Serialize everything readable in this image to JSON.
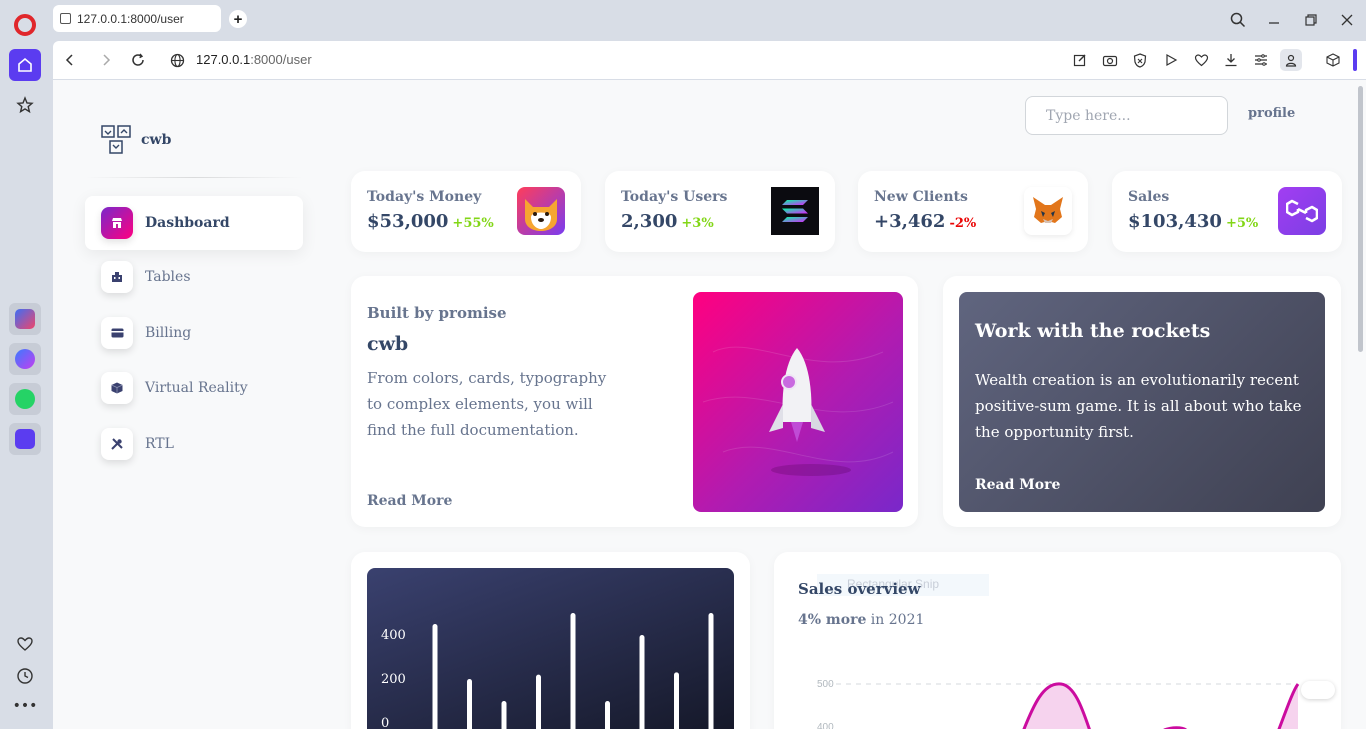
{
  "browser": {
    "tab_title": "127.0.0.1:8000/user",
    "url_host": "127.0.0.1",
    "url_rest": ":8000/user"
  },
  "page": {
    "brand": "cwb",
    "search_placeholder": "Type here...",
    "profile_label": "profile",
    "nav": [
      {
        "label": "Dashboard",
        "icon": "shop-icon",
        "active": true
      },
      {
        "label": "Tables",
        "icon": "office-icon"
      },
      {
        "label": "Billing",
        "icon": "credit-card-icon"
      },
      {
        "label": "Virtual Reality",
        "icon": "box-3d-icon"
      },
      {
        "label": "RTL",
        "icon": "settings-tools-icon"
      }
    ],
    "stats": [
      {
        "label": "Today's Money",
        "value": "$53,000",
        "change": "+55%",
        "icon": "shiba-inu-icon"
      },
      {
        "label": "Today's Users",
        "value": "2,300",
        "change": "+3%",
        "icon": "solana-icon"
      },
      {
        "label": "New Clients",
        "value": "+3,462",
        "change": "-2%",
        "icon": "metamask-fox-icon"
      },
      {
        "label": "Sales",
        "value": "$103,430",
        "change": "+5%",
        "icon": "polygon-icon"
      }
    ],
    "promise": {
      "subtitle": "Built by promise",
      "title": "cwb",
      "text": "From colors, cards, typography to complex elements, you will find the full documentation.",
      "read_more": "Read More"
    },
    "rockets": {
      "title": "Work with the rockets",
      "text": "Wealth creation is an evolutionarily recent positive-sum game. It is all about who take the opportunity first.",
      "read_more": "Read More"
    },
    "sales": {
      "title": "Sales overview",
      "sub_bold": "4% more",
      "sub_rest": " in 2021",
      "overlay_text": "Rectangular Snip"
    }
  },
  "chart_data": [
    {
      "type": "bar",
      "title": "",
      "yticks": [
        "400",
        "200",
        "0"
      ],
      "values": [
        450,
        200,
        100,
        220,
        500,
        100,
        400,
        230,
        500
      ],
      "ylim": [
        0,
        500
      ],
      "grid": false
    },
    {
      "type": "line",
      "title": "Sales overview",
      "yticks": [
        "500",
        "400"
      ],
      "note": "curve partially visible; peaks near 500",
      "colors": {
        "line": "#cb0c9f"
      }
    }
  ]
}
